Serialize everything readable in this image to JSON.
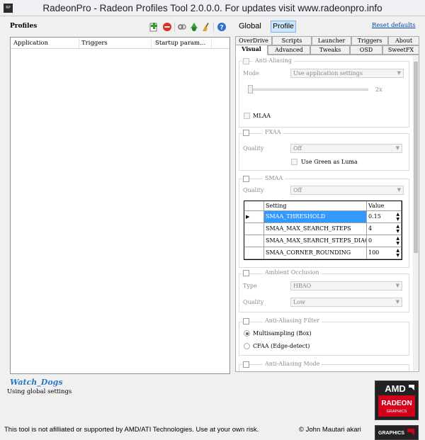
{
  "window": {
    "title": "RadeonPro - Radeon Profiles Tool 2.0.0.0. For updates visit www.radeonpro.info",
    "icon": "RP"
  },
  "profiles": {
    "label": "Profiles",
    "columns": [
      "Application",
      "Triggers",
      "Startup param..."
    ],
    "selected_profile": "Watch_Dogs",
    "profile_status": "Using global settings"
  },
  "toolbar": {
    "icons": [
      "add-profile-icon",
      "delete-profile-icon",
      "link-icon",
      "recycle-icon",
      "broom-icon",
      "help-icon"
    ]
  },
  "mode": {
    "global_label": "Global",
    "profile_label": "Profile",
    "reset_label": "Reset defaults"
  },
  "tabs": {
    "row1": [
      "OverDrive",
      "Scripts",
      "Launcher",
      "Triggers",
      "About"
    ],
    "row2": [
      "Visual",
      "Advanced",
      "Tweaks",
      "OSD",
      "SweetFX"
    ],
    "active": "Visual"
  },
  "antialiasing": {
    "label": "Anti-Aliasing",
    "mode_label": "Mode",
    "mode_value": "Use application settings",
    "slider_value": "2x",
    "mlaa_label": "MLAA"
  },
  "fxaa": {
    "label": "FXAA",
    "quality_label": "Quality",
    "quality_value": "Off",
    "green_luma_label": "Use Green as Luma"
  },
  "smaa": {
    "label": "SMAA",
    "quality_label": "Quality",
    "quality_value": "Off",
    "table": {
      "headers": [
        "Setting",
        "Value"
      ],
      "rows": [
        {
          "setting": "SMAA_THRESHOLD",
          "value": "0.15"
        },
        {
          "setting": "SMAA_MAX_SEARCH_STEPS",
          "value": "4"
        },
        {
          "setting": "SMAA_MAX_SEARCH_STEPS_DIAG",
          "value": "0"
        },
        {
          "setting": "SMAA_CORNER_ROUNDING",
          "value": "100"
        }
      ]
    }
  },
  "ambient_occlusion": {
    "label": "Ambient Occlusion",
    "type_label": "Type",
    "type_value": "HBAO",
    "quality_label": "Quality",
    "quality_value": "Low"
  },
  "aa_filter": {
    "label": "Anti-Aliasing Filter",
    "option1": "Multisampling (Box)",
    "option2": "CFAA (Edge-detect)",
    "selected": "Multisampling (Box)"
  },
  "aa_mode": {
    "label": "Anti-Aliasing Mode"
  },
  "status_bar": {
    "left": "This tool is not afilliated or supported by AMD/ATI Technologies. Use at your own risk.",
    "right": "© John Mautari akari"
  },
  "logo": {
    "brand": "AMD",
    "line1": "RADEON",
    "line2": "GRAPHICS",
    "second": "GRAPHICS"
  },
  "colors": {
    "accent": "#3399ff",
    "link": "#0645ad",
    "amd_red": "#d3001b"
  }
}
